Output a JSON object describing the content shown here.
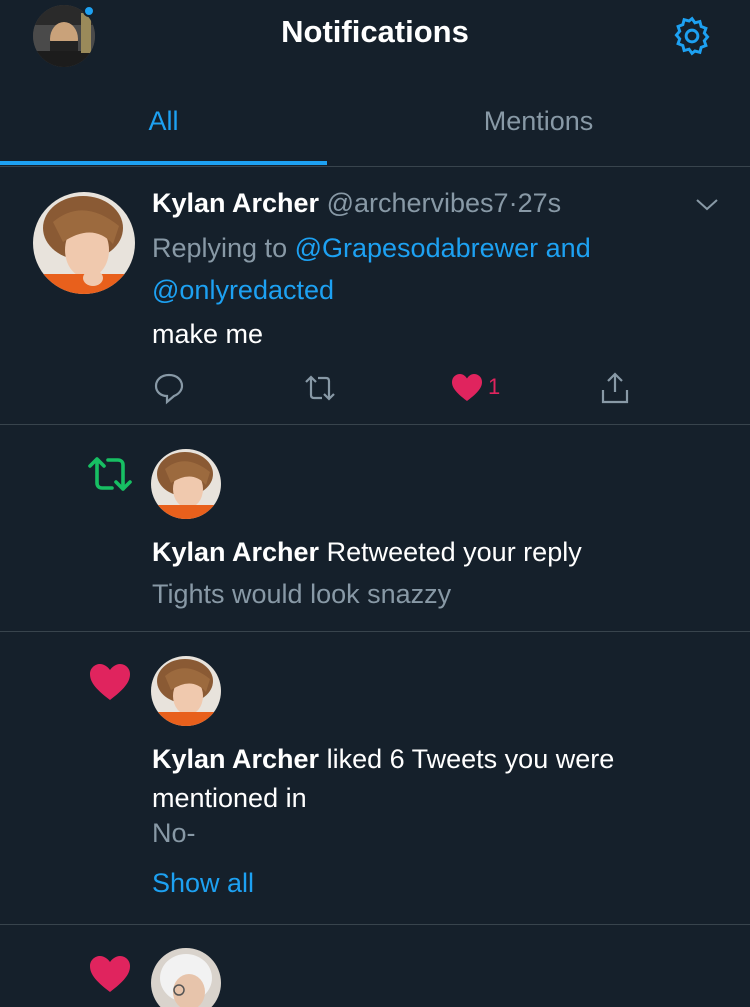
{
  "header": {
    "title": "Notifications",
    "icons": {
      "avatar": "profile-avatar",
      "settings": "gear-icon"
    }
  },
  "tabs": [
    {
      "label": "All",
      "active": true
    },
    {
      "label": "Mentions",
      "active": false
    }
  ],
  "tweet": {
    "name": "Kylan Archer",
    "handle": "@archervibes7",
    "separator": "·",
    "time": "27s",
    "replying_prefix": "Replying to",
    "replying_user1": "@Grapesodabrewer",
    "replying_and": "and",
    "replying_user2": "@onlyredacted",
    "text": "make me",
    "like_count": "1"
  },
  "retweet_notification": {
    "name": "Kylan Archer",
    "action": "Retweeted your reply",
    "preview": "Tights would look snazzy"
  },
  "like_notification": {
    "name": "Kylan Archer",
    "action": "liked 6 Tweets you were mentioned in",
    "preview": "No-",
    "show_all": "Show all"
  },
  "colors": {
    "background": "#15202b",
    "accent": "#1da1f2",
    "like": "#e0245e",
    "retweet": "#17bf63",
    "muted": "#8899a6",
    "divider": "#38444d"
  }
}
